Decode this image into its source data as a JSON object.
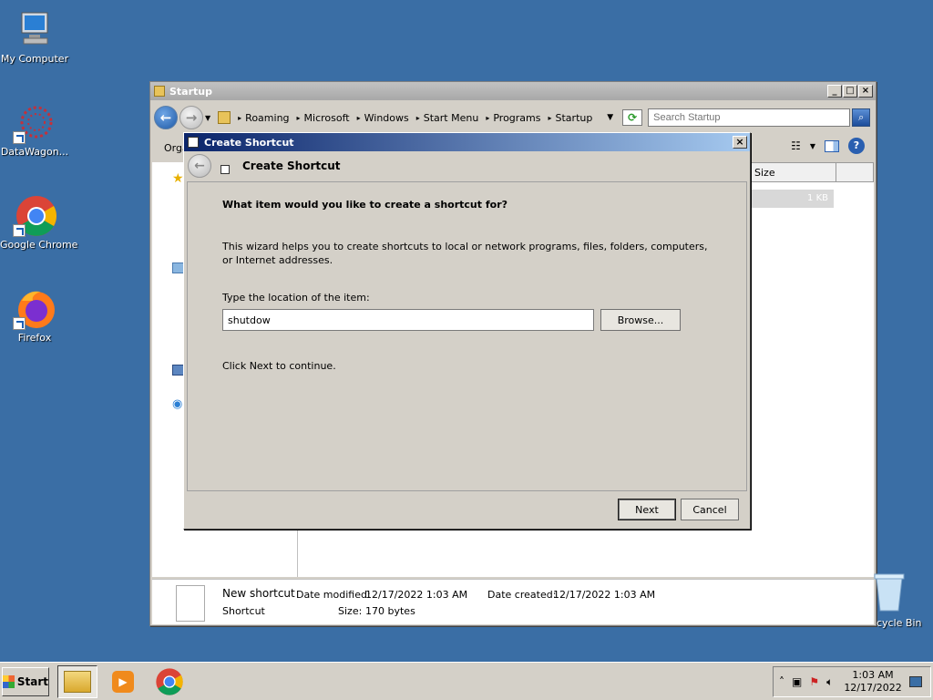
{
  "desktop": {
    "icons": [
      {
        "label": "My Computer"
      },
      {
        "label": "DataWagon..."
      },
      {
        "label": "Google Chrome"
      },
      {
        "label": "Firefox"
      }
    ],
    "recycle_label": "cycle Bin"
  },
  "explorer": {
    "title": "Startup",
    "breadcrumbs": [
      "Roaming",
      "Microsoft",
      "Windows",
      "Start Menu",
      "Programs",
      "Startup"
    ],
    "search_placeholder": "Search Startup",
    "organize_label": "Orga",
    "column_size": "Size",
    "file_size": "1 KB",
    "details": {
      "name": "New shortcut",
      "type": "Shortcut",
      "date_modified_label": "Date modified:",
      "date_modified": "12/17/2022 1:03 AM",
      "date_created_label": "Date created:",
      "date_created": "12/17/2022 1:03 AM",
      "size_label": "Size:",
      "size": "170 bytes"
    }
  },
  "wizard": {
    "title": "Create Shortcut",
    "header": "Create Shortcut",
    "question": "What item would you like to create a shortcut for?",
    "description": "This wizard helps you to create shortcuts to local or network programs, files, folders, computers, or Internet addresses.",
    "location_label": "Type the location of the item:",
    "location_value": "shutdow",
    "browse_label": "Browse...",
    "continue_text": "Click Next to continue.",
    "next_label": "Next",
    "cancel_label": "Cancel"
  },
  "taskbar": {
    "start_label": "Start",
    "clock_time": "1:03 AM",
    "clock_date": "12/17/2022"
  }
}
